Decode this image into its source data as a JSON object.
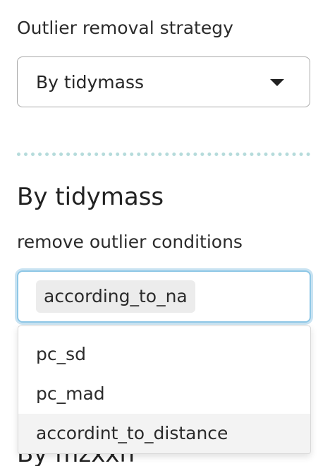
{
  "strategy": {
    "label": "Outlier removal strategy",
    "selected_value": "By tidymass"
  },
  "section": {
    "title": "By tidymass"
  },
  "conditions": {
    "label": "remove outlier conditions",
    "selected_chips": [
      "according_to_na"
    ],
    "options": [
      "pc_sd",
      "pc_mad",
      "accordint_to_distance"
    ],
    "highlighted_option": "accordint_to_distance"
  },
  "below_heading_partial": "By mzxxh",
  "colors": {
    "focus_ring": "#8ec7e6",
    "divider": "#b5dbdb",
    "chip_bg": "#ececec",
    "option_highlight": "#f3f3f3"
  }
}
